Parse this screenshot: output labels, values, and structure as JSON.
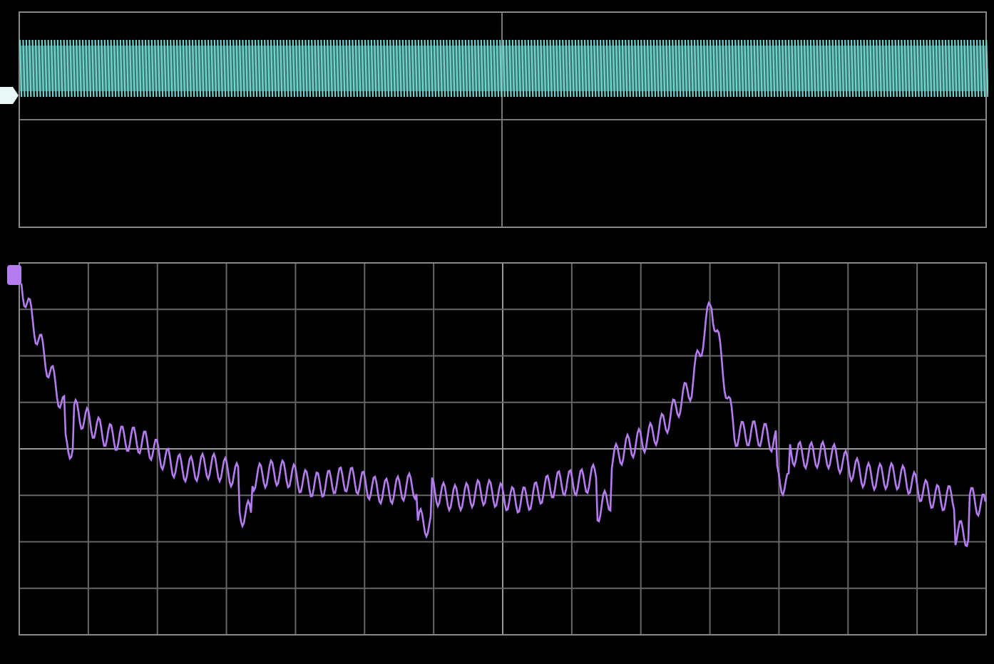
{
  "panels": [
    {
      "kind": "time",
      "color": "#6fd6cf"
    },
    {
      "kind": "spectrum",
      "color": "#b57cf0"
    }
  ]
}
